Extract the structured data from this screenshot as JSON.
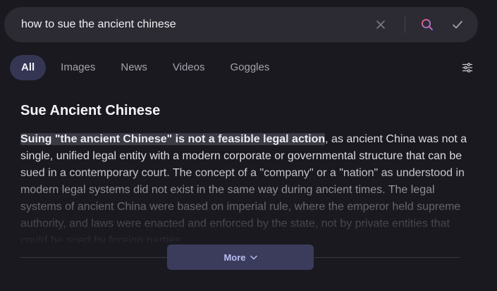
{
  "search": {
    "query": "how to sue the ancient chinese"
  },
  "tabs": [
    {
      "label": "All",
      "active": true
    },
    {
      "label": "Images",
      "active": false
    },
    {
      "label": "News",
      "active": false
    },
    {
      "label": "Videos",
      "active": false
    },
    {
      "label": "Goggles",
      "active": false
    }
  ],
  "answer": {
    "title": "Sue Ancient Chinese",
    "highlight": "Suing \"the ancient Chinese\" is not a feasible legal action",
    "body": ", as ancient China was not a single, unified legal entity with a modern corporate or governmental structure that can be sued in a contemporary court. The concept of a \"company\" or a \"nation\" as understood in modern legal systems did not exist in the same way during ancient times. The legal systems of ancient China were based on imperial rule, where the emperor held supreme authority, and laws were enacted and enforced by the state, not by private entities that could be sued by foreign parties.",
    "more_label": "More"
  },
  "icons": {
    "clear": "close-icon",
    "search": "search-icon",
    "submit": "check-icon",
    "filters": "sliders-icon",
    "more": "chevron-down-icon"
  },
  "colors": {
    "background": "#1a191f",
    "searchbar": "#2c2b33",
    "active_tab": "#343654",
    "more_button": "#3b3c5c",
    "search_icon_gradient": [
      "#ff5a72",
      "#8f7bff"
    ]
  }
}
